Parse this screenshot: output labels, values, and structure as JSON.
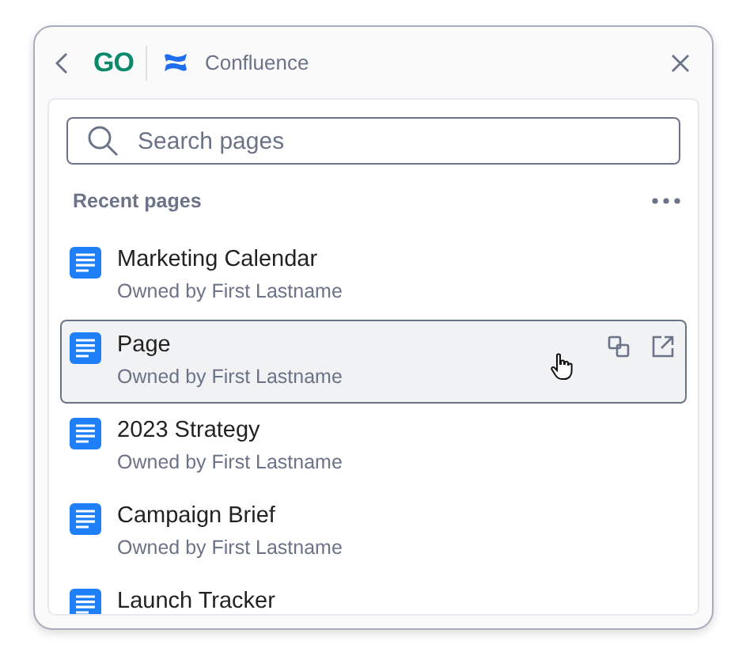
{
  "header": {
    "logo": "GO",
    "app": "Confluence"
  },
  "search": {
    "placeholder": "Search pages"
  },
  "section": {
    "title": "Recent pages"
  },
  "pages": [
    {
      "title": "Marketing Calendar",
      "owner": "Owned by First Lastname",
      "selected": false
    },
    {
      "title": "Page",
      "owner": "Owned by First Lastname",
      "selected": true
    },
    {
      "title": "2023 Strategy",
      "owner": "Owned by First Lastname",
      "selected": false
    },
    {
      "title": "Campaign Brief",
      "owner": "Owned by First Lastname",
      "selected": false
    },
    {
      "title": "Launch Tracker",
      "selected": false
    }
  ]
}
